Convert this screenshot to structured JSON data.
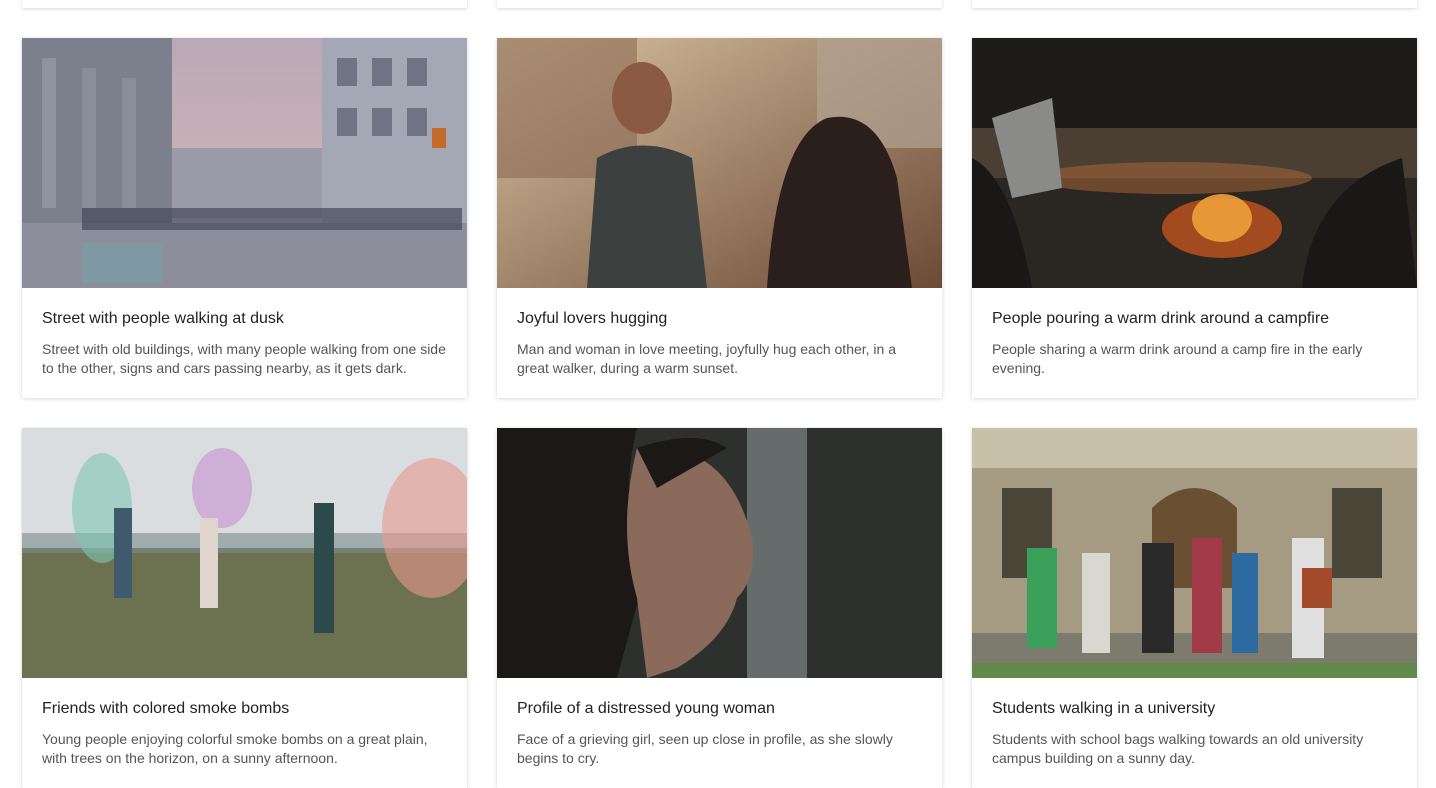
{
  "cards": [
    {
      "title": "Street with people walking at dusk",
      "description": "Street with old buildings, with many people walking from one side to the other, signs and cars passing nearby, as it gets dark.",
      "image": "city-street-dusk-thumbnail"
    },
    {
      "title": "Joyful lovers hugging",
      "description": "Man and woman in love meeting, joyfully hug each other, in a great walker, during a warm sunset.",
      "image": "couple-sunset-thumbnail"
    },
    {
      "title": "People pouring a warm drink around a campfire",
      "description": "People sharing a warm drink around a camp fire in the early evening.",
      "image": "campfire-thumbnail"
    },
    {
      "title": "Friends with colored smoke bombs",
      "description": "Young people enjoying colorful smoke bombs on a great plain, with trees on the horizon, on a sunny afternoon.",
      "image": "smoke-bombs-field-thumbnail"
    },
    {
      "title": "Profile of a distressed young woman",
      "description": "Face of a grieving girl, seen up close in profile, as she slowly begins to cry.",
      "image": "woman-profile-thumbnail"
    },
    {
      "title": "Students walking in a university",
      "description": "Students with school bags walking towards an old university campus building on a sunny day.",
      "image": "university-students-thumbnail"
    }
  ]
}
